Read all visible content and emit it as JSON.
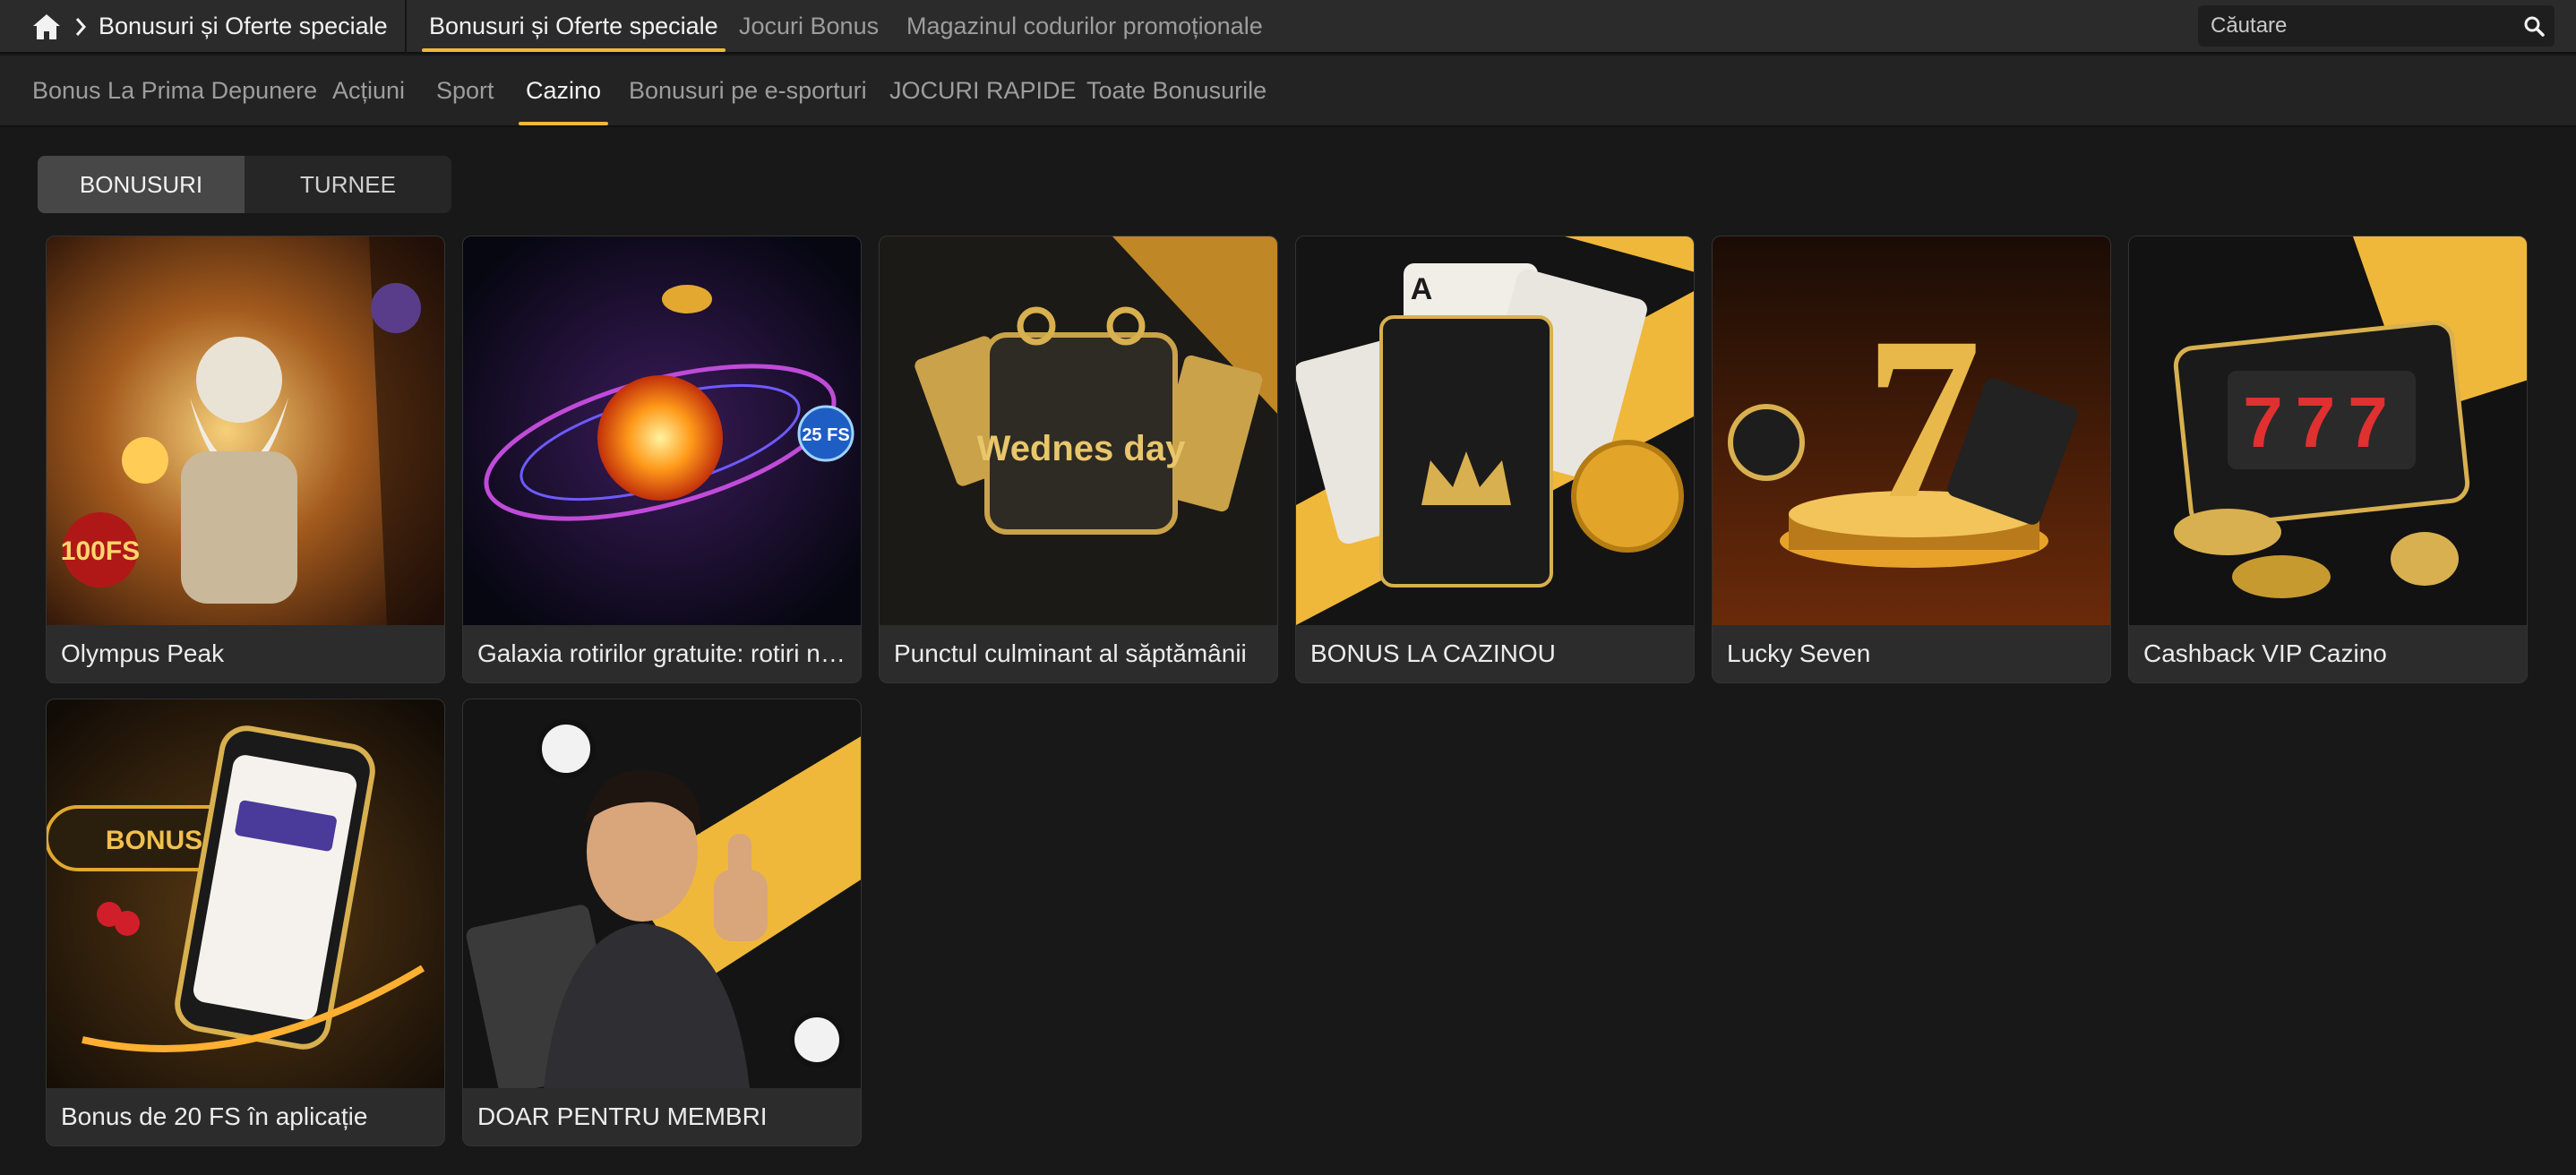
{
  "breadcrumb": {
    "home_icon": "home-icon",
    "separator_icon": "chevron-right-icon",
    "current": "Bonusuri și Oferte speciale"
  },
  "top_tabs": [
    {
      "label": "Bonusuri și Oferte speciale",
      "active": true
    },
    {
      "label": "Jocuri Bonus",
      "active": false
    },
    {
      "label": "Magazinul codurilor promoționale",
      "active": false
    }
  ],
  "search": {
    "placeholder": "Căutare",
    "icon": "search-icon"
  },
  "sub_tabs": [
    {
      "label": "Bonus La Prima Depunere",
      "active": false
    },
    {
      "label": "Acțiuni",
      "active": false
    },
    {
      "label": "Sport",
      "active": false
    },
    {
      "label": "Cazino",
      "active": true
    },
    {
      "label": "Bonusuri pe e-sporturi",
      "active": false
    },
    {
      "label": "JOCURI RAPIDE",
      "active": false
    },
    {
      "label": "Toate Bonusurile",
      "active": false
    }
  ],
  "segments": [
    {
      "label": "BONUSURI",
      "active": true
    },
    {
      "label": "TURNEE",
      "active": false
    }
  ],
  "cards": [
    {
      "title": "Olympus Peak",
      "badge": "100FS"
    },
    {
      "title": "Galaxia rotirilor gratuite: rotiri nelimitate",
      "badge": "25 FS"
    },
    {
      "title": "Punctul culminant al săptămânii",
      "badge": "Wednes day"
    },
    {
      "title": "BONUS LA CAZINOU",
      "badge": "A"
    },
    {
      "title": "Lucky Seven",
      "badge": "7"
    },
    {
      "title": "Cashback VIP Cazino",
      "badge": "777"
    },
    {
      "title": "Bonus de 20 FS în aplicație",
      "badge": "BONUS"
    },
    {
      "title": "DOAR PENTRU MEMBRI",
      "badge": ""
    }
  ],
  "colors": {
    "accent": "#f0b83a",
    "background": "#181818",
    "card": "#2c2c2c"
  }
}
